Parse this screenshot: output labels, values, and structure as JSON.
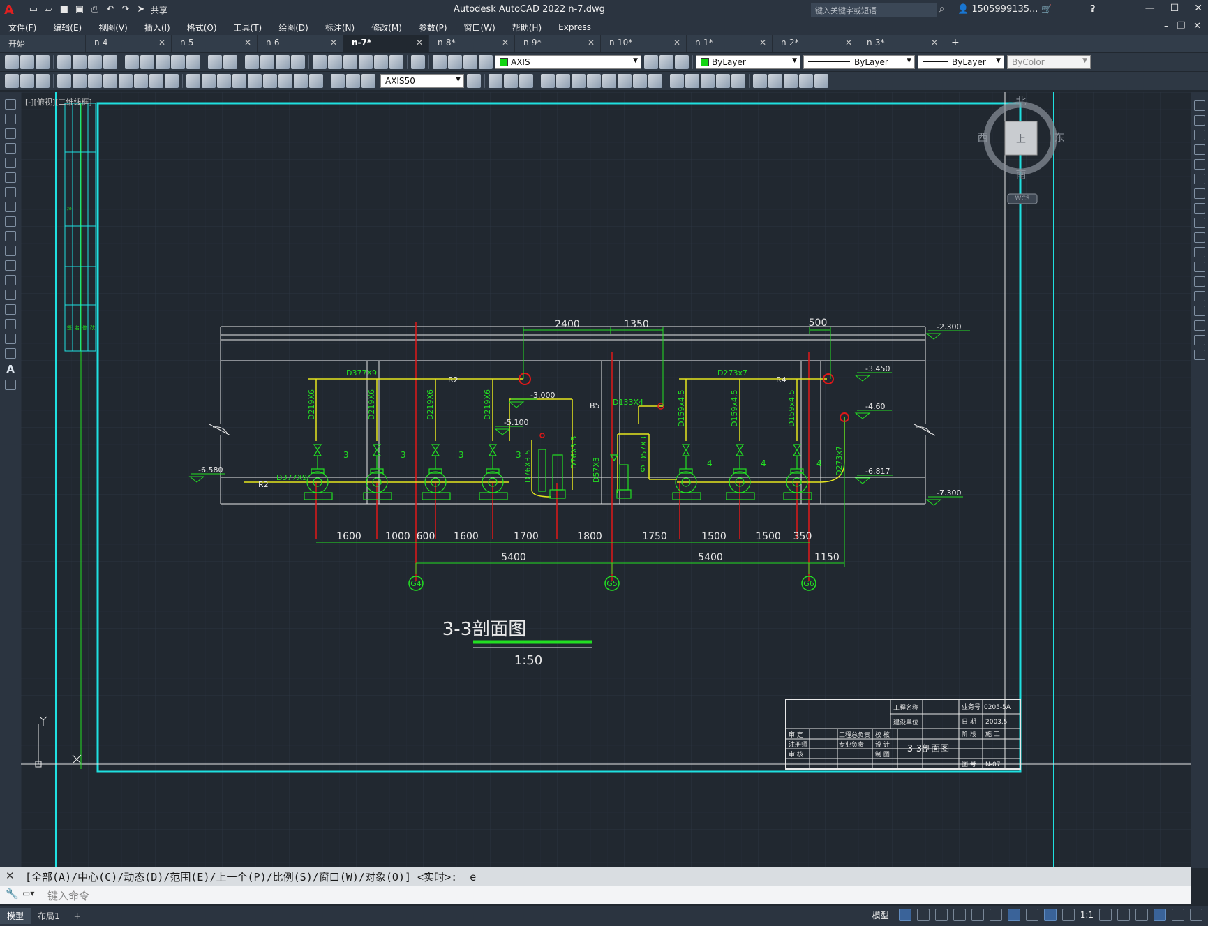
{
  "app": {
    "logo": "A",
    "title": "Autodesk AutoCAD 2022    n-7.dwg",
    "share_label": "共享",
    "search_placeholder": "键入关键字或短语",
    "user": "1505999135...",
    "help": "?"
  },
  "menu": [
    "文件(F)",
    "编辑(E)",
    "视图(V)",
    "插入(I)",
    "格式(O)",
    "工具(T)",
    "绘图(D)",
    "标注(N)",
    "修改(M)",
    "参数(P)",
    "窗口(W)",
    "帮助(H)",
    "Express"
  ],
  "tabs": [
    {
      "label": "开始",
      "active": false
    },
    {
      "label": "n-4",
      "active": false
    },
    {
      "label": "n-5",
      "active": false
    },
    {
      "label": "n-6",
      "active": false
    },
    {
      "label": "n-7*",
      "active": true
    },
    {
      "label": "n-8*",
      "active": false
    },
    {
      "label": "n-9*",
      "active": false
    },
    {
      "label": "n-10*",
      "active": false
    },
    {
      "label": "n-1*",
      "active": false
    },
    {
      "label": "n-2*",
      "active": false
    },
    {
      "label": "n-3*",
      "active": false
    }
  ],
  "toolbar": {
    "layer": "AXIS",
    "color": "ByLayer",
    "linetype": "ByLayer",
    "lineweight": "ByLayer",
    "plotstyle": "ByColor",
    "dimstyle": "AXIS50"
  },
  "viewport": {
    "label": "[-][俯视][二维线框]",
    "viewcube": {
      "north": "北",
      "south": "南",
      "east": "东",
      "west": "西",
      "top": "上",
      "wcs": "WCS"
    }
  },
  "drawing": {
    "title": "3-3剖面图",
    "scale": "1:50",
    "top_dims": [
      "2400",
      "1350",
      "500"
    ],
    "bottom_dims": [
      "1600",
      "1000",
      "600",
      "1600",
      "1700",
      "1800",
      "1750",
      "1500",
      "1500",
      "350"
    ],
    "axis_dims": [
      "5400",
      "5400",
      "1150"
    ],
    "axes": [
      "G4",
      "G5",
      "G6"
    ],
    "elevations": [
      "-2.300",
      "-3.450",
      "-4.60",
      "-6.817",
      "-7.300",
      "-6.580",
      "-3.000",
      "-5.100"
    ],
    "pipe_labels": [
      "D377X9",
      "R2",
      "D273x7",
      "R4",
      "D133X4",
      "B5",
      "D377X9",
      "R2",
      "D219X6",
      "D219X6",
      "D219X6",
      "D219X6",
      "D76X3.5",
      "D76X3.5",
      "D57X3",
      "D57X3",
      "D159x4.5",
      "D159x4.5",
      "D159x4.5",
      "D273x7"
    ],
    "pump_tags": [
      "3",
      "3",
      "3",
      "3",
      "6",
      "4",
      "4",
      "4"
    ],
    "titleblock": {
      "project_label": "工程名称",
      "build_label": "建设单位",
      "job_no_label": "业务号",
      "job_no": "0205-5A",
      "date_label": "日 期",
      "date": "2003.5",
      "stage_label": "阶 段",
      "stage": "施 工",
      "drawing_no_label": "图 号",
      "drawing_no": "N-07",
      "sheet_title": "3-3剖面图",
      "roles": [
        "审 定",
        "注册师",
        "审 核",
        "工程总负责",
        "专业负责",
        "校 核",
        "设 计",
        "制 图"
      ]
    },
    "left_strip": [
      "签",
      "名",
      "修",
      "改",
      "栏"
    ]
  },
  "command": {
    "history": "[全部(A)/中心(C)/动态(D)/范围(E)/上一个(P)/比例(S)/窗口(W)/对象(O)] <实时>: _e",
    "placeholder": "键入命令"
  },
  "status": {
    "tabs": [
      "模型",
      "布局1"
    ],
    "model": "模型",
    "scale": "1:1"
  },
  "colors": {
    "cyan": "#1fe0e0",
    "green": "#22e022",
    "yellow": "#e6e61e",
    "red": "#e01818",
    "white": "#e8e8e8"
  }
}
